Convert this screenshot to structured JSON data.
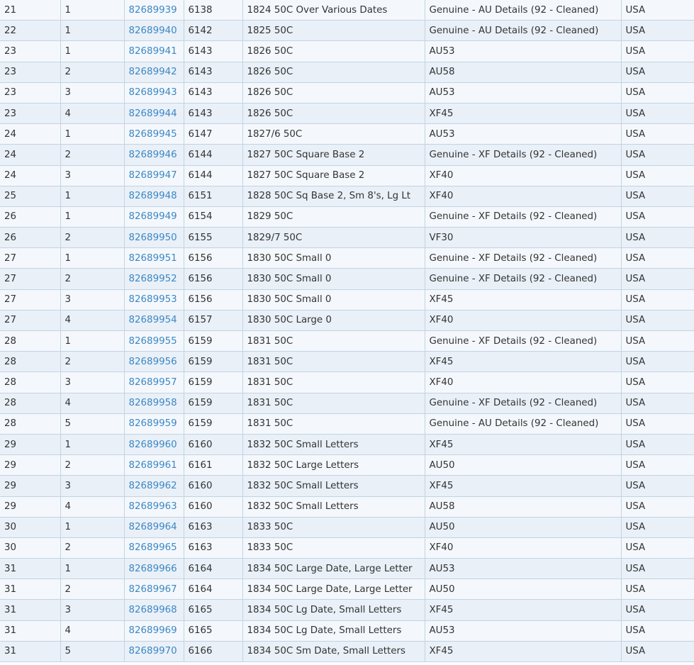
{
  "link_color": "#3d87c4",
  "rows": [
    {
      "lot": "21",
      "line": "1",
      "cert": "82689939",
      "pcgs": "6138",
      "desc": "1824 50C Over Various Dates",
      "grade": "Genuine - AU Details (92 - Cleaned)",
      "country": "USA"
    },
    {
      "lot": "22",
      "line": "1",
      "cert": "82689940",
      "pcgs": "6142",
      "desc": "1825 50C",
      "grade": "Genuine - AU Details (92 - Cleaned)",
      "country": "USA"
    },
    {
      "lot": "23",
      "line": "1",
      "cert": "82689941",
      "pcgs": "6143",
      "desc": "1826 50C",
      "grade": "AU53",
      "country": "USA"
    },
    {
      "lot": "23",
      "line": "2",
      "cert": "82689942",
      "pcgs": "6143",
      "desc": "1826 50C",
      "grade": "AU58",
      "country": "USA"
    },
    {
      "lot": "23",
      "line": "3",
      "cert": "82689943",
      "pcgs": "6143",
      "desc": "1826 50C",
      "grade": "AU53",
      "country": "USA"
    },
    {
      "lot": "23",
      "line": "4",
      "cert": "82689944",
      "pcgs": "6143",
      "desc": "1826 50C",
      "grade": "XF45",
      "country": "USA"
    },
    {
      "lot": "24",
      "line": "1",
      "cert": "82689945",
      "pcgs": "6147",
      "desc": "1827/6 50C",
      "grade": "AU53",
      "country": "USA"
    },
    {
      "lot": "24",
      "line": "2",
      "cert": "82689946",
      "pcgs": "6144",
      "desc": "1827 50C Square Base 2",
      "grade": "Genuine - XF Details (92 - Cleaned)",
      "country": "USA"
    },
    {
      "lot": "24",
      "line": "3",
      "cert": "82689947",
      "pcgs": "6144",
      "desc": "1827 50C Square Base 2",
      "grade": "XF40",
      "country": "USA"
    },
    {
      "lot": "25",
      "line": "1",
      "cert": "82689948",
      "pcgs": "6151",
      "desc": "1828 50C Sq Base 2, Sm 8's, Lg Lt",
      "grade": "XF40",
      "country": "USA"
    },
    {
      "lot": "26",
      "line": "1",
      "cert": "82689949",
      "pcgs": "6154",
      "desc": "1829 50C",
      "grade": "Genuine - XF Details (92 - Cleaned)",
      "country": "USA"
    },
    {
      "lot": "26",
      "line": "2",
      "cert": "82689950",
      "pcgs": "6155",
      "desc": "1829/7 50C",
      "grade": "VF30",
      "country": "USA"
    },
    {
      "lot": "27",
      "line": "1",
      "cert": "82689951",
      "pcgs": "6156",
      "desc": "1830 50C Small 0",
      "grade": "Genuine - XF Details (92 - Cleaned)",
      "country": "USA"
    },
    {
      "lot": "27",
      "line": "2",
      "cert": "82689952",
      "pcgs": "6156",
      "desc": "1830 50C Small 0",
      "grade": "Genuine - XF Details (92 - Cleaned)",
      "country": "USA"
    },
    {
      "lot": "27",
      "line": "3",
      "cert": "82689953",
      "pcgs": "6156",
      "desc": "1830 50C Small 0",
      "grade": "XF45",
      "country": "USA"
    },
    {
      "lot": "27",
      "line": "4",
      "cert": "82689954",
      "pcgs": "6157",
      "desc": "1830 50C Large 0",
      "grade": "XF40",
      "country": "USA"
    },
    {
      "lot": "28",
      "line": "1",
      "cert": "82689955",
      "pcgs": "6159",
      "desc": "1831 50C",
      "grade": "Genuine - XF Details (92 - Cleaned)",
      "country": "USA"
    },
    {
      "lot": "28",
      "line": "2",
      "cert": "82689956",
      "pcgs": "6159",
      "desc": "1831 50C",
      "grade": "XF45",
      "country": "USA"
    },
    {
      "lot": "28",
      "line": "3",
      "cert": "82689957",
      "pcgs": "6159",
      "desc": "1831 50C",
      "grade": "XF40",
      "country": "USA"
    },
    {
      "lot": "28",
      "line": "4",
      "cert": "82689958",
      "pcgs": "6159",
      "desc": "1831 50C",
      "grade": "Genuine - XF Details (92 - Cleaned)",
      "country": "USA"
    },
    {
      "lot": "28",
      "line": "5",
      "cert": "82689959",
      "pcgs": "6159",
      "desc": "1831 50C",
      "grade": "Genuine - AU Details (92 - Cleaned)",
      "country": "USA"
    },
    {
      "lot": "29",
      "line": "1",
      "cert": "82689960",
      "pcgs": "6160",
      "desc": "1832 50C Small Letters",
      "grade": "XF45",
      "country": "USA"
    },
    {
      "lot": "29",
      "line": "2",
      "cert": "82689961",
      "pcgs": "6161",
      "desc": "1832 50C Large Letters",
      "grade": "AU50",
      "country": "USA"
    },
    {
      "lot": "29",
      "line": "3",
      "cert": "82689962",
      "pcgs": "6160",
      "desc": "1832 50C Small Letters",
      "grade": "XF45",
      "country": "USA"
    },
    {
      "lot": "29",
      "line": "4",
      "cert": "82689963",
      "pcgs": "6160",
      "desc": "1832 50C Small Letters",
      "grade": "AU58",
      "country": "USA"
    },
    {
      "lot": "30",
      "line": "1",
      "cert": "82689964",
      "pcgs": "6163",
      "desc": "1833 50C",
      "grade": "AU50",
      "country": "USA"
    },
    {
      "lot": "30",
      "line": "2",
      "cert": "82689965",
      "pcgs": "6163",
      "desc": "1833 50C",
      "grade": "XF40",
      "country": "USA"
    },
    {
      "lot": "31",
      "line": "1",
      "cert": "82689966",
      "pcgs": "6164",
      "desc": "1834 50C Large Date, Large Letter",
      "grade": "AU53",
      "country": "USA"
    },
    {
      "lot": "31",
      "line": "2",
      "cert": "82689967",
      "pcgs": "6164",
      "desc": "1834 50C Large Date, Large Letter",
      "grade": "AU50",
      "country": "USA"
    },
    {
      "lot": "31",
      "line": "3",
      "cert": "82689968",
      "pcgs": "6165",
      "desc": "1834 50C Lg Date, Small Letters",
      "grade": "XF45",
      "country": "USA"
    },
    {
      "lot": "31",
      "line": "4",
      "cert": "82689969",
      "pcgs": "6165",
      "desc": "1834 50C Lg Date, Small Letters",
      "grade": "AU53",
      "country": "USA"
    },
    {
      "lot": "31",
      "line": "5",
      "cert": "82689970",
      "pcgs": "6166",
      "desc": "1834 50C Sm Date, Small Letters",
      "grade": "XF45",
      "country": "USA"
    }
  ]
}
